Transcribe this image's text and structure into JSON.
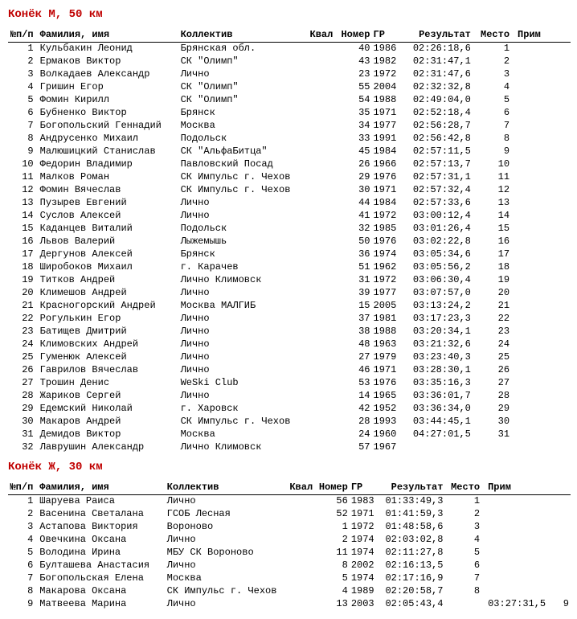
{
  "columns": {
    "num": "№п/п",
    "name": "Фамилия, имя",
    "team": "Коллектив",
    "qual": "Квал",
    "bib": "Номер",
    "year": "ГР",
    "result": "Результат",
    "place": "Место",
    "note": "Прим"
  },
  "sections": [
    {
      "title": "Конёк М, 50 км",
      "rows": [
        {
          "n": "1",
          "name": "Кульбакин Леонид",
          "team": "Брянская обл.",
          "qual": "",
          "bib": "40",
          "year": "1986",
          "res": "02:26:18,6",
          "place": "1",
          "note": ""
        },
        {
          "n": "2",
          "name": "Ермаков Виктор",
          "team": "СК \"Олимп\"",
          "qual": "",
          "bib": "43",
          "year": "1982",
          "res": "02:31:47,1",
          "place": "2",
          "note": ""
        },
        {
          "n": "3",
          "name": "Волкадаев Александр",
          "team": "Лично",
          "qual": "",
          "bib": "23",
          "year": "1972",
          "res": "02:31:47,6",
          "place": "3",
          "note": ""
        },
        {
          "n": "4",
          "name": "Гришин Егор",
          "team": "СК \"Олимп\"",
          "qual": "",
          "bib": "55",
          "year": "2004",
          "res": "02:32:32,8",
          "place": "4",
          "note": ""
        },
        {
          "n": "5",
          "name": "Фомин Кирилл",
          "team": "СК \"Олимп\"",
          "qual": "",
          "bib": "54",
          "year": "1988",
          "res": "02:49:04,0",
          "place": "5",
          "note": ""
        },
        {
          "n": "6",
          "name": "Бубненко Виктор",
          "team": "Брянск",
          "qual": "",
          "bib": "35",
          "year": "1971",
          "res": "02:52:18,4",
          "place": "6",
          "note": ""
        },
        {
          "n": "7",
          "name": "Богопольский Геннадий",
          "team": "Москва",
          "qual": "",
          "bib": "34",
          "year": "1977",
          "res": "02:56:28,7",
          "place": "7",
          "note": ""
        },
        {
          "n": "8",
          "name": "Андрусенко Михаил",
          "team": "Подольск",
          "qual": "",
          "bib": "33",
          "year": "1991",
          "res": "02:56:42,8",
          "place": "8",
          "note": ""
        },
        {
          "n": "9",
          "name": "Малюшицкий Станислав",
          "team": "СК \"АльфаБитца\"",
          "qual": "",
          "bib": "45",
          "year": "1984",
          "res": "02:57:11,5",
          "place": "9",
          "note": ""
        },
        {
          "n": "10",
          "name": "Федорин Владимир",
          "team": "Павловский Посад",
          "qual": "",
          "bib": "26",
          "year": "1966",
          "res": "02:57:13,7",
          "place": "10",
          "note": ""
        },
        {
          "n": "11",
          "name": "Малков Роман",
          "team": "СК Импульс г. Чехов",
          "qual": "",
          "bib": "29",
          "year": "1976",
          "res": "02:57:31,1",
          "place": "11",
          "note": ""
        },
        {
          "n": "12",
          "name": "Фомин Вячеслав",
          "team": "СК Импульс г. Чехов",
          "qual": "",
          "bib": "30",
          "year": "1971",
          "res": "02:57:32,4",
          "place": "12",
          "note": ""
        },
        {
          "n": "13",
          "name": "Пузырев Евгений",
          "team": "Лично",
          "qual": "",
          "bib": "44",
          "year": "1984",
          "res": "02:57:33,6",
          "place": "13",
          "note": ""
        },
        {
          "n": "14",
          "name": "Суслов Алексей",
          "team": "Лично",
          "qual": "",
          "bib": "41",
          "year": "1972",
          "res": "03:00:12,4",
          "place": "14",
          "note": ""
        },
        {
          "n": "15",
          "name": "Каданцев Виталий",
          "team": "Подольск",
          "qual": "",
          "bib": "32",
          "year": "1985",
          "res": "03:01:26,4",
          "place": "15",
          "note": ""
        },
        {
          "n": "16",
          "name": "Львов Валерий",
          "team": "Лыжемышь",
          "qual": "",
          "bib": "50",
          "year": "1976",
          "res": "03:02:22,8",
          "place": "16",
          "note": ""
        },
        {
          "n": "17",
          "name": "Дергунов Алексей",
          "team": "Брянск",
          "qual": "",
          "bib": "36",
          "year": "1974",
          "res": "03:05:34,6",
          "place": "17",
          "note": ""
        },
        {
          "n": "18",
          "name": "Широбоков Михаил",
          "team": "г. Карачев",
          "qual": "",
          "bib": "51",
          "year": "1962",
          "res": "03:05:56,2",
          "place": "18",
          "note": ""
        },
        {
          "n": "19",
          "name": "Титков Андрей",
          "team": "Лично Климовск",
          "qual": "",
          "bib": "31",
          "year": "1972",
          "res": "03:06:30,4",
          "place": "19",
          "note": ""
        },
        {
          "n": "20",
          "name": "Климешов Андрей",
          "team": "Лично",
          "qual": "",
          "bib": "39",
          "year": "1977",
          "res": "03:07:57,0",
          "place": "20",
          "note": ""
        },
        {
          "n": "21",
          "name": "Красногорский Андрей",
          "team": "Москва МАЛГИБ",
          "qual": "",
          "bib": "15",
          "year": "2005",
          "res": "03:13:24,2",
          "place": "21",
          "note": ""
        },
        {
          "n": "22",
          "name": "Рогулькин Егор",
          "team": "Лично",
          "qual": "",
          "bib": "37",
          "year": "1981",
          "res": "03:17:23,3",
          "place": "22",
          "note": ""
        },
        {
          "n": "23",
          "name": "Батищев Дмитрий",
          "team": "Лично",
          "qual": "",
          "bib": "38",
          "year": "1988",
          "res": "03:20:34,1",
          "place": "23",
          "note": ""
        },
        {
          "n": "24",
          "name": "Климовских Андрей",
          "team": "Лично",
          "qual": "",
          "bib": "48",
          "year": "1963",
          "res": "03:21:32,6",
          "place": "24",
          "note": ""
        },
        {
          "n": "25",
          "name": "Гуменюк Алексей",
          "team": "Лично",
          "qual": "",
          "bib": "27",
          "year": "1979",
          "res": "03:23:40,3",
          "place": "25",
          "note": ""
        },
        {
          "n": "26",
          "name": "Гаврилов Вячеслав",
          "team": "Лично",
          "qual": "",
          "bib": "46",
          "year": "1971",
          "res": "03:28:30,1",
          "place": "26",
          "note": ""
        },
        {
          "n": "27",
          "name": "Трошин Денис",
          "team": "WeSki Club",
          "qual": "",
          "bib": "53",
          "year": "1976",
          "res": "03:35:16,3",
          "place": "27",
          "note": ""
        },
        {
          "n": "28",
          "name": "Жариков Сергей",
          "team": "Лично",
          "qual": "",
          "bib": "14",
          "year": "1965",
          "res": "03:36:01,7",
          "place": "28",
          "note": ""
        },
        {
          "n": "29",
          "name": "Едемский Николай",
          "team": "г. Харовск",
          "qual": "",
          "bib": "42",
          "year": "1952",
          "res": "03:36:34,0",
          "place": "29",
          "note": ""
        },
        {
          "n": "30",
          "name": "Макаров Андрей",
          "team": "СК Импульс г. Чехов",
          "qual": "",
          "bib": "28",
          "year": "1993",
          "res": "03:44:45,1",
          "place": "30",
          "note": ""
        },
        {
          "n": "31",
          "name": "Демидов Виктор",
          "team": "Москва",
          "qual": "",
          "bib": "24",
          "year": "1960",
          "res": "04:27:01,5",
          "place": "31",
          "note": ""
        },
        {
          "n": "32",
          "name": "Лаврушин Александр",
          "team": "Лично Климовск",
          "qual": "",
          "bib": "57",
          "year": "1967",
          "res": "",
          "place": "",
          "note": ""
        }
      ]
    },
    {
      "title": "Конёк Ж, 30 км",
      "rows": [
        {
          "n": "1",
          "name": "Шаруева Раиса",
          "team": "Лично",
          "qual": "",
          "bib": "56",
          "year": "1983",
          "res": "01:33:49,3",
          "place": "1",
          "note": ""
        },
        {
          "n": "2",
          "name": "Васенина Светалана",
          "team": "ГСОБ Лесная",
          "qual": "",
          "bib": "52",
          "year": "1971",
          "res": "01:41:59,3",
          "place": "2",
          "note": ""
        },
        {
          "n": "3",
          "name": "Астапова Виктория",
          "team": "Вороново",
          "qual": "",
          "bib": "1",
          "year": "1972",
          "res": "01:48:58,6",
          "place": "3",
          "note": ""
        },
        {
          "n": "4",
          "name": "Овечкина Оксана",
          "team": "Лично",
          "qual": "",
          "bib": "2",
          "year": "1974",
          "res": "02:03:02,8",
          "place": "4",
          "note": ""
        },
        {
          "n": "5",
          "name": "Володина Ирина",
          "team": "МБУ СК Вороново",
          "qual": "",
          "bib": "11",
          "year": "1974",
          "res": "02:11:27,8",
          "place": "5",
          "note": ""
        },
        {
          "n": "6",
          "name": "Булташева Анастасия",
          "team": "Лично",
          "qual": "",
          "bib": "8",
          "year": "2002",
          "res": "02:16:13,5",
          "place": "6",
          "note": ""
        },
        {
          "n": "7",
          "name": "Богопольская Елена",
          "team": "Москва",
          "qual": "",
          "bib": "5",
          "year": "1974",
          "res": "02:17:16,9",
          "place": "7",
          "note": ""
        },
        {
          "n": "8",
          "name": "Макарова Оксана",
          "team": "СК Импульс г. Чехов",
          "qual": "",
          "bib": "4",
          "year": "1989",
          "res": "02:20:58,7",
          "place": "8",
          "note": ""
        },
        {
          "n": "9",
          "name": "Матвеева Марина",
          "team": "Лично",
          "qual": "",
          "bib": "13",
          "year": "2003",
          "res": "02:05:43,4",
          "place": "",
          "note": "03:27:31,5   9"
        }
      ]
    }
  ]
}
